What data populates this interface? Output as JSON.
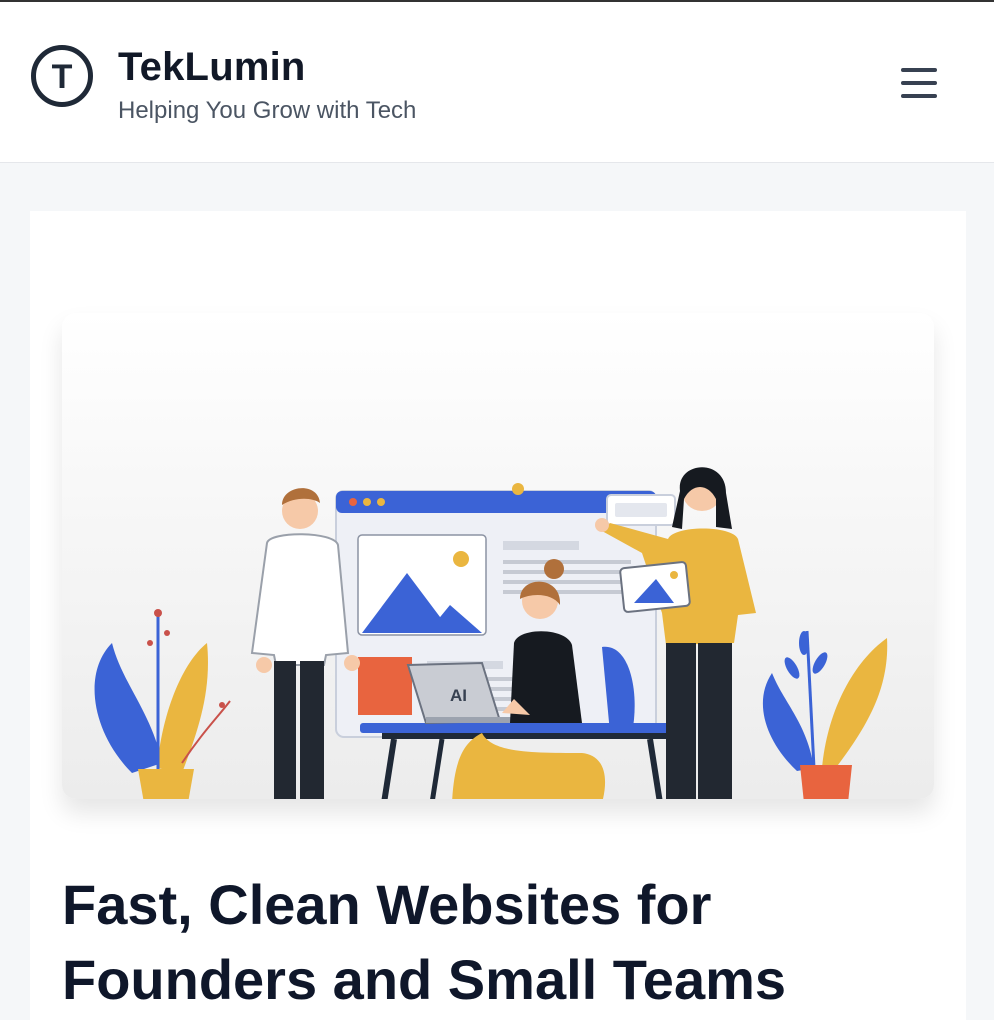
{
  "header": {
    "brand_name": "TekLumin",
    "tagline": "Helping You Grow with Tech",
    "logo_letter": "T",
    "menu_icon": "hamburger-menu-icon"
  },
  "hero": {
    "illustration_laptop_label": "AI",
    "title_line1": "Fast, Clean Websites for",
    "title_line2": "Founders and Small Teams"
  },
  "colors": {
    "brand_dark": "#1f2937",
    "accent_blue": "#3b63d6",
    "accent_yellow": "#eab640",
    "accent_orange": "#e8643f",
    "page_bg": "#f5f7f9"
  }
}
